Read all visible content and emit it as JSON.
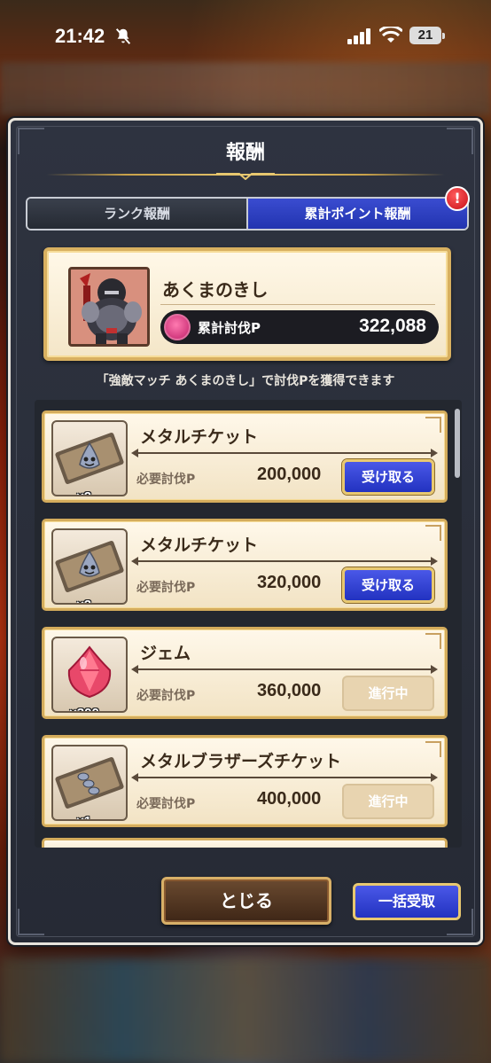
{
  "status": {
    "time": "21:42",
    "battery": "21"
  },
  "dialog": {
    "title": "報酬",
    "tabs": [
      {
        "label": "ランク報酬",
        "active": false
      },
      {
        "label": "累計ポイント報酬",
        "active": true
      }
    ],
    "tab_badge": "!",
    "monster": {
      "name": "あくまのきし",
      "points_label": "累計討伐P",
      "points_value": "322,088"
    },
    "hint": "「強敵マッチ あくまのきし」で討伐Pを獲得できます",
    "rewards": [
      {
        "name": "メタルチケット",
        "qty": "×2",
        "req_label": "必要討伐P",
        "req_value": "200,000",
        "action": "受け取る",
        "state": "claim",
        "icon": "metal-ticket-icon"
      },
      {
        "name": "メタルチケット",
        "qty": "×2",
        "req_label": "必要討伐P",
        "req_value": "320,000",
        "action": "受け取る",
        "state": "claim",
        "icon": "metal-ticket-icon"
      },
      {
        "name": "ジェム",
        "qty": "×300",
        "req_label": "必要討伐P",
        "req_value": "360,000",
        "action": "進行中",
        "state": "progress",
        "icon": "gem-icon"
      },
      {
        "name": "メタルブラザーズチケット",
        "qty": "×1",
        "req_label": "必要討伐P",
        "req_value": "400,000",
        "action": "進行中",
        "state": "progress",
        "icon": "metal-brothers-ticket-icon"
      }
    ],
    "close_label": "とじる",
    "bulk_label": "一括受取"
  },
  "colors": {
    "accent_blue": "#2c3cc8",
    "gold_border": "#d4ac5c",
    "panel_bg": "#2a2e38"
  }
}
